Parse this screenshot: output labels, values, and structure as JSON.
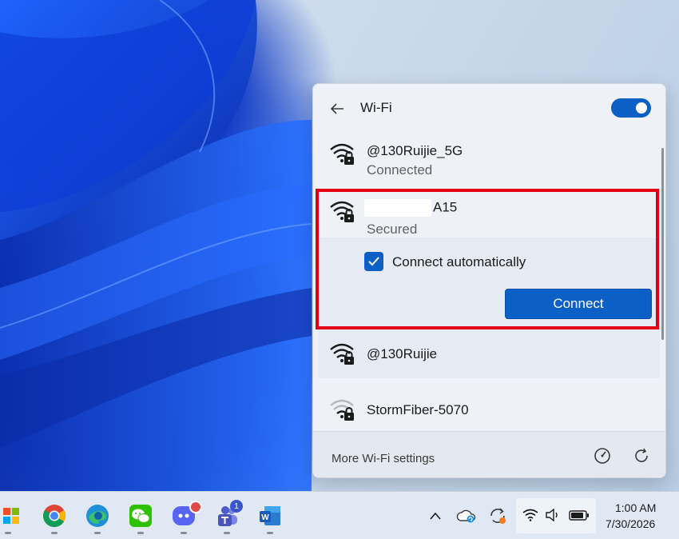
{
  "flyout": {
    "title": "Wi-Fi",
    "toggle_on": true,
    "networks": [
      {
        "name": "@130Ruijie_5G",
        "status": "Connected",
        "signal": "strong",
        "secured": true
      },
      {
        "name_suffix": "A15",
        "status": "Secured",
        "signal": "strong",
        "secured": true,
        "name_redacted": true
      },
      {
        "name": "@130Ruijie",
        "signal": "strong",
        "secured": true
      },
      {
        "name": "StormFiber-5070",
        "signal": "weak",
        "secured": true
      }
    ],
    "auto_connect_label": "Connect automatically",
    "auto_connect_checked": true,
    "connect_label": "Connect",
    "footer": {
      "more_settings": "More Wi-Fi settings",
      "icons": [
        "speedometer-icon",
        "refresh-icon"
      ]
    }
  },
  "taskbar": {
    "apps": [
      "windows-start-icon",
      "chrome-icon",
      "edge-icon",
      "wechat-icon",
      "discord-icon",
      "teams-icon",
      "word-icon"
    ],
    "teams_badge": "1",
    "tray_icons": [
      "chevron-up-icon",
      "onedrive-icon",
      "sync-icon",
      "wifi-icon",
      "volume-icon",
      "battery-icon"
    ],
    "time": "1:00 AM",
    "date": "7/30/2026"
  },
  "colors": {
    "accent": "#0c5fc4",
    "highlight": "#e00012"
  }
}
